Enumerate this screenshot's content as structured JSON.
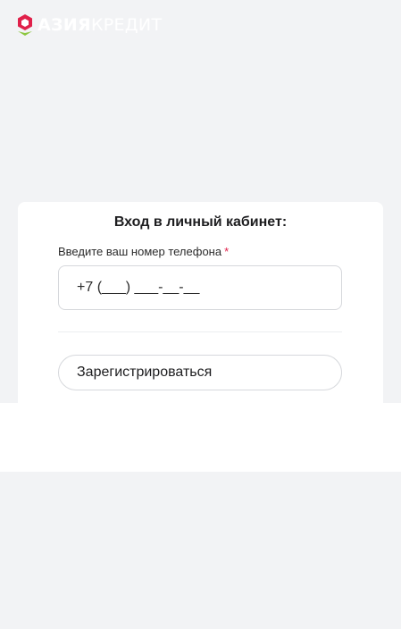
{
  "brand": {
    "logo_bold": "АЗИЯ",
    "logo_light": "КРЕДИТ",
    "accent_color": "#e0204a",
    "secondary_color": "#8cc63f"
  },
  "login": {
    "title": "Вход в личный кабинет:",
    "phone_label": "Введите ваш номер телефона",
    "required_mark": "*",
    "phone_placeholder": "+7 (___) ___-__-__",
    "register_label": "Зарегистрироваться"
  }
}
